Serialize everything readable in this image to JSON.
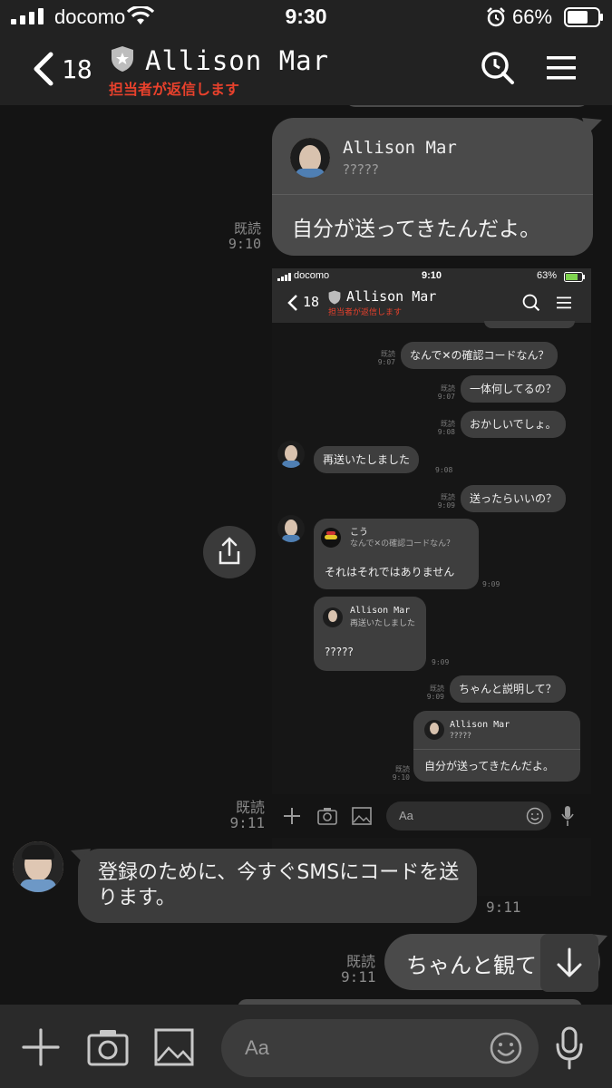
{
  "status_bar": {
    "carrier": "docomo",
    "time": "9:30",
    "battery_percent": "66%"
  },
  "header": {
    "unread_count": "18",
    "contact_name": "Allison Mar",
    "subtitle": "担当者が返信します"
  },
  "messages": {
    "reply_card": {
      "sender": "Allison Mar",
      "quoted": "?????",
      "text": "自分が送ってきたんだよ。",
      "read": "既読",
      "time": "9:10"
    },
    "screenshot": {
      "status": {
        "carrier": "docomo",
        "time": "9:10",
        "battery": "63%"
      },
      "header": {
        "count": "18",
        "name": "Allison Mar",
        "subtitle": "担当者が返信します"
      },
      "items": [
        {
          "side": "right",
          "text": "なんで✕の確認コードなん？",
          "read": "既読",
          "time": "9:07"
        },
        {
          "side": "right",
          "text": "一体何してるの？",
          "read": "既読",
          "time": "9:07"
        },
        {
          "side": "right",
          "text": "おかしいでしょ。",
          "read": "既読",
          "time": "9:08"
        },
        {
          "side": "left",
          "text": "再送いたしました",
          "time": "9:08"
        },
        {
          "side": "right",
          "text": "送ったらいいの？",
          "read": "既読",
          "time": "9:09"
        }
      ],
      "reply1": {
        "sender": "こう",
        "quoted": "なんで✕の確認コードなん？",
        "text": "それはそれではありません",
        "time": "9:09"
      },
      "reply2": {
        "sender": "Allison Mar",
        "quoted": "再送いたしました",
        "text": "?????",
        "time": "9:09"
      },
      "explain": {
        "text": "ちゃんと説明して？",
        "read": "既読",
        "time": "9:09"
      },
      "reply3": {
        "sender": "Allison Mar",
        "quoted": "?????",
        "text": "自分が送ってきたんだよ。",
        "read": "既読",
        "time": "9:10"
      },
      "input_placeholder": "Aa"
    },
    "screenshot_meta": {
      "read": "既読",
      "time": "9:11"
    },
    "incoming": {
      "text": "登録のために、今すぐSMSにコードを送ります。",
      "time": "9:11"
    },
    "outgoing": {
      "text": "ちゃんと観て",
      "read": "既読",
      "time": "9:11"
    }
  },
  "input": {
    "placeholder": "Aa"
  },
  "colors": {
    "accent_red": "#e8412c",
    "bubble": "#4a4a4a",
    "background": "#141414"
  },
  "icons": [
    "signal-icon",
    "wifi-icon",
    "alarm-icon",
    "battery-icon",
    "back-chevron-icon",
    "shield-icon",
    "search-icon",
    "menu-icon",
    "share-icon",
    "scroll-down-icon",
    "plus-icon",
    "camera-icon",
    "image-icon",
    "emoji-icon",
    "mic-icon"
  ]
}
